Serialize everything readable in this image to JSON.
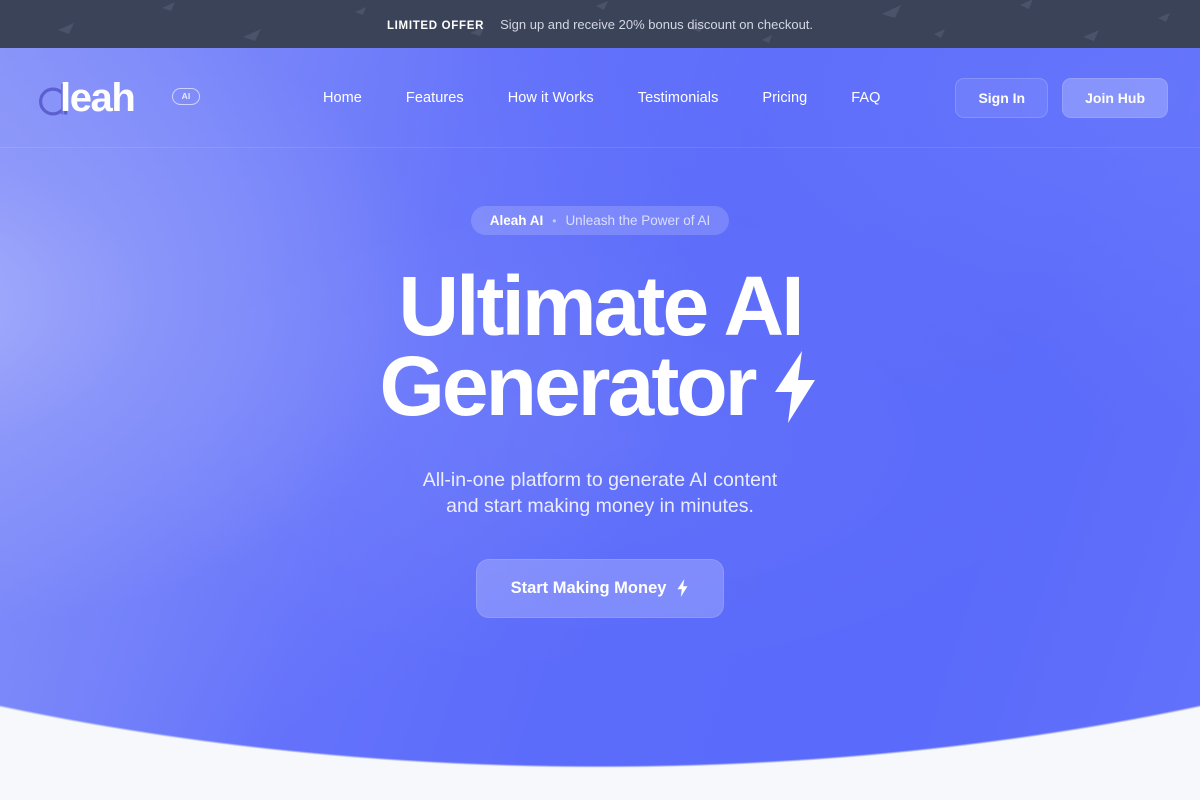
{
  "banner": {
    "tag": "LIMITED OFFER",
    "text": "Sign up and receive 20% bonus discount on checkout."
  },
  "header": {
    "logo": {
      "word": "leah",
      "badge": "AI",
      "mark_icon": "letter-a-outline-icon"
    },
    "nav": [
      {
        "label": "Home"
      },
      {
        "label": "Features"
      },
      {
        "label": "How it Works"
      },
      {
        "label": "Testimonials"
      },
      {
        "label": "Pricing"
      },
      {
        "label": "FAQ"
      }
    ],
    "sign_in_label": "Sign In",
    "join_label": "Join Hub"
  },
  "hero": {
    "eyebrow_brand": "Aleah AI",
    "eyebrow_separator": "•",
    "eyebrow_tag": "Unleash the Power of AI",
    "headline_line1": "Ultimate AI",
    "headline_line2": "Generator",
    "headline_icon": "lightning-bolt-icon",
    "subtitle_line1": "All-in-one platform to generate AI content",
    "subtitle_line2": "and start making money in minutes.",
    "cta_label": "Start Making Money",
    "cta_icon": "lightning-bolt-icon"
  },
  "colors": {
    "banner_bg": "#3b4359",
    "hero_blue": "#5b6bfa",
    "hero_blue_light": "#8e99f8",
    "page_bg": "#f7f8fb",
    "text_white": "#ffffff"
  }
}
